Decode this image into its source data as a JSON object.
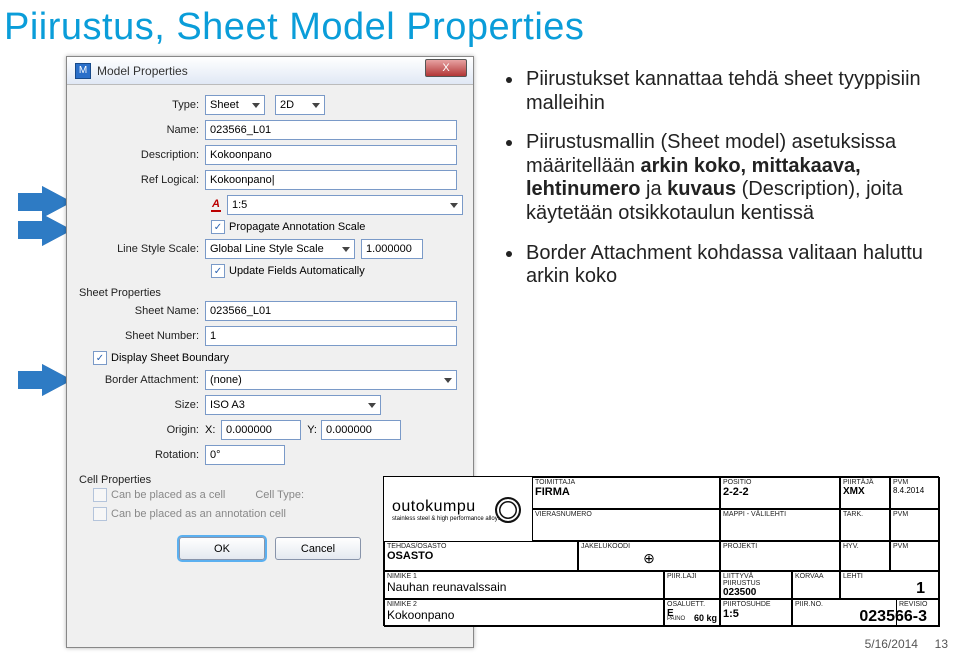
{
  "slide_title": "Piirustus, Sheet Model Properties",
  "dialog": {
    "title": "Model Properties",
    "type_lbl": "Type:",
    "type_val": "Sheet",
    "dim_val": "2D",
    "name_lbl": "Name:",
    "name_val": "023566_L01",
    "desc_lbl": "Description:",
    "desc_val": "Kokoonpano",
    "reflog_lbl": "Ref Logical:",
    "reflog_val": "Kokoonpano|",
    "scale_val": "1:5",
    "prop_scale": "Propagate Annotation Scale",
    "lss_lbl": "Line Style Scale:",
    "lss_val": "Global Line Style Scale",
    "lss_num": "1.000000",
    "upd_fields": "Update Fields Automatically",
    "sheet_hdr": "Sheet Properties",
    "sheetname_lbl": "Sheet Name:",
    "sheetname_val": "023566_L01",
    "sheetnum_lbl": "Sheet Number:",
    "sheetnum_val": "1",
    "disp_bound": "Display Sheet Boundary",
    "border_lbl": "Border Attachment:",
    "border_val": "(none)",
    "size_lbl": "Size:",
    "size_val": "ISO A3",
    "origin_lbl": "Origin:",
    "origin_x": "X:",
    "origin_xv": "0.000000",
    "origin_y": "Y:",
    "origin_yv": "0.000000",
    "rot_lbl": "Rotation:",
    "rot_val": "0°",
    "cell_hdr": "Cell Properties",
    "cell_chk1": "Can be placed as a cell",
    "celltype_lbl": "Cell Type:",
    "cell_chk2": "Can be placed as an annotation cell",
    "ok": "OK",
    "cancel": "Cancel"
  },
  "bullets": {
    "b1": "Piirustukset kannattaa tehdä sheet tyyppisiin malleihin",
    "b2_a": "Piirustusmallin (Sheet model) asetuksissa määritellään ",
    "b2_b": "arkin koko, mittakaava, lehtinumero",
    "b2_c": " ja ",
    "b2_d": "kuvaus",
    "b2_e": " (Description), joita käytetään otsikkotaulun kentissä",
    "b3": "Border Attachment kohdassa valitaan haluttu arkin koko"
  },
  "tblk": {
    "toimittaja_h": "TOIMITTAJA",
    "firma": "FIRMA",
    "werasnumero_h": "VIERASNUMERO",
    "tehdas_h": "TEHDAS/OSASTO",
    "osasto": "OSASTO",
    "jakelu_h": "JAKELUKOODI",
    "nimike1_h": "NIMIKE 1",
    "nim1": "Nauhan reunavalssain",
    "nimike2_h": "NIMIKE 2",
    "nim2": "Kokoonpano",
    "piirlaji_h": "PIIR.LAJI",
    "positio_h": "POSITIO",
    "positio": "2-2-2",
    "mappi_h": "MAPPI - VÄLILEHTI",
    "piirtaja_h": "PIIRTÄJÄ",
    "piirtaja": "XMX",
    "pvm_h": "PVM",
    "pvm": "8.4.2014",
    "tark_h": "TARK.",
    "projekti_h": "PROJEKTI",
    "hyv_h": "HYV.",
    "liittyva_h": "LIITTYVÄ PIIRUSTUS",
    "liittyva": "023500",
    "korvaa_h": "KORVAA",
    "lehti_h": "LEHTI",
    "lehti": "1",
    "osaluett_h": "OSALUETT.",
    "osaluett": "E",
    "piirtosuhde_h": "PIIRTOSUHDE",
    "piirtosuhde": "1:5",
    "piirno_h": "PIIR.NO.",
    "piirno": "023566-3",
    "paino_h": "PAINO",
    "paino": "60 kg",
    "revisio_h": "REVISIO",
    "outokumpu": "outokumpu",
    "outokumpu_sub": "stainless steel & high performance alloys"
  },
  "footer_date": "5/16/2014",
  "footer_page": "13"
}
